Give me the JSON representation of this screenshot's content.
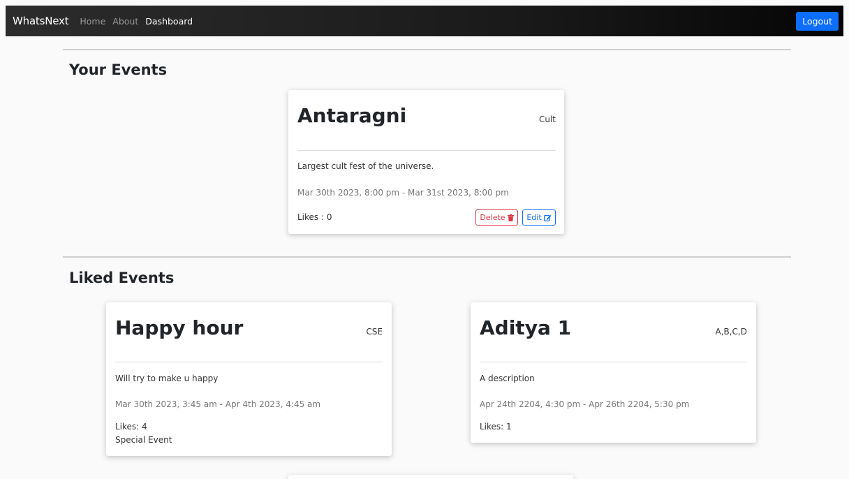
{
  "navbar": {
    "brand": "WhatsNext",
    "links": [
      "Home",
      "About",
      "Dashboard"
    ],
    "logout_label": "Logout"
  },
  "sections": {
    "your_events_title": "Your Events",
    "liked_events_title": "Liked Events"
  },
  "your_events": [
    {
      "title": "Antaragni",
      "tag": "Cult",
      "description": "Largest cult fest of the universe.",
      "dates": "Mar 30th 2023, 8:00 pm - Mar 31st 2023, 8:00 pm",
      "likes": "Likes : 0",
      "delete_label": "Delete",
      "edit_label": "Edit"
    }
  ],
  "liked_events": [
    {
      "title": "Happy hour",
      "tag": "CSE",
      "description": "Will try to make u happy",
      "dates": "Mar 30th 2023, 3:45 am - Apr 4th 2023, 4:45 am",
      "likes": "Likes: 4",
      "special": "Special Event"
    },
    {
      "title": "Aditya 1",
      "tag": "A,B,C,D",
      "description": "A description",
      "dates": "Apr 24th 2204, 4:30 pm - Apr 26th 2204, 5:30 pm",
      "likes": "Likes: 1"
    }
  ],
  "colors": {
    "primary": "#0d6efd",
    "danger": "#dc3545",
    "navbar_bg": "#1a1a1a"
  },
  "icons": {
    "delete": "trash-icon",
    "edit": "edit-icon"
  }
}
